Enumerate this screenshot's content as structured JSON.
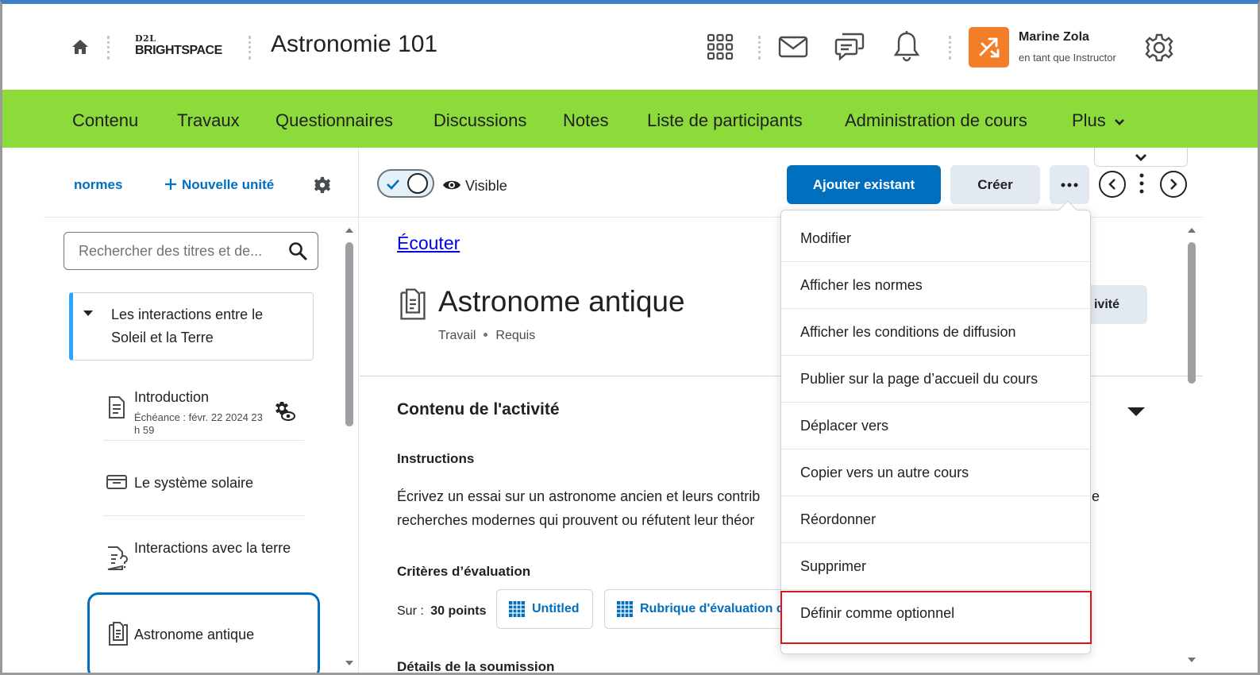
{
  "header": {
    "logo_small": "D2L",
    "logo_big": "BRIGHTSPACE",
    "course_title": "Astronomie 101",
    "user_name": "Marine Zola",
    "user_role": "en tant que Instructor"
  },
  "nav": {
    "items": [
      "Contenu",
      "Travaux",
      "Questionnaires",
      "Discussions",
      "Notes",
      "Liste de participants",
      "Administration de cours",
      "Plus"
    ]
  },
  "sidebar": {
    "normes_link": "normes",
    "new_unit_label": "Nouvelle unité",
    "search_placeholder": "Rechercher des titres et de...",
    "unit_title": "Les interactions entre le Soleil et la Terre",
    "items": [
      {
        "title": "Introduction",
        "due": "Échéance : févr. 22 2024 23 h 59"
      },
      {
        "title": "Le système solaire"
      },
      {
        "title": "Interactions avec la terre"
      },
      {
        "title": "Astronome antique"
      }
    ]
  },
  "toolbar": {
    "visible_label": "Visible",
    "add_existing": "Ajouter existant",
    "create": "Créer"
  },
  "content": {
    "listen_link": "Écouter",
    "title": "Astronome antique",
    "meta_type": "Travail",
    "meta_required": "Requis",
    "hidden_btn_partial": "ivité",
    "section_title": "Contenu de l'activité",
    "instructions_heading": "Instructions",
    "instructions_line1": "Écrivez un essai sur un astronome ancien et leurs contrib",
    "instructions_line1_end": "e",
    "instructions_line2": "recherches modernes qui prouvent ou réfutent leur théor",
    "criteria_heading": "Critères d’évaluation",
    "grade_label": "Sur :",
    "grade_value": "30 points",
    "rubric_1": "Untitled",
    "rubric_2": "Rubrique d'évaluation d",
    "submission_heading_partial": "Détails de la soumission"
  },
  "menu": {
    "items": [
      "Modifier",
      "Afficher les normes",
      "Afficher les conditions de diffusion",
      "Publier sur la page d’accueil du cours",
      "Déplacer vers",
      "Copier vers un autre cours",
      "Réordonner",
      "Supprimer",
      "Définir comme optionnel"
    ],
    "highlighted_index": 8
  },
  "colors": {
    "nav_bg": "#8ddb3a",
    "primary": "#006fbf",
    "avatar": "#f37e2a",
    "highlight": "#e0121b"
  }
}
